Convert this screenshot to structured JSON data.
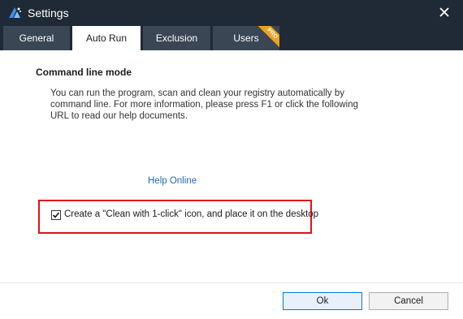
{
  "window": {
    "title": "Settings",
    "app_icon": "app-logo-icon",
    "close_icon": "close-icon"
  },
  "tabs": [
    {
      "label": "General",
      "active": false
    },
    {
      "label": "Auto Run",
      "active": true
    },
    {
      "label": "Exclusion",
      "active": false
    },
    {
      "label": "Users",
      "active": false,
      "badge": "PRO"
    }
  ],
  "content": {
    "heading": "Command line mode",
    "description": "You can run the program, scan and clean your registry automatically by command line. For more information, please press F1 or click the following URL to read our help documents.",
    "help_link": "Help Online",
    "checkbox": {
      "label": "Create a \"Clean with 1-click\" icon, and place it on the desktop",
      "checked": true
    }
  },
  "footer": {
    "ok_label": "Ok",
    "cancel_label": "Cancel"
  },
  "colors": {
    "titlebar": "#1f2a36",
    "tab_inactive": "#3a4654",
    "link": "#2468b0",
    "highlight": "#e0111b",
    "pro_badge": "#f0a020"
  }
}
